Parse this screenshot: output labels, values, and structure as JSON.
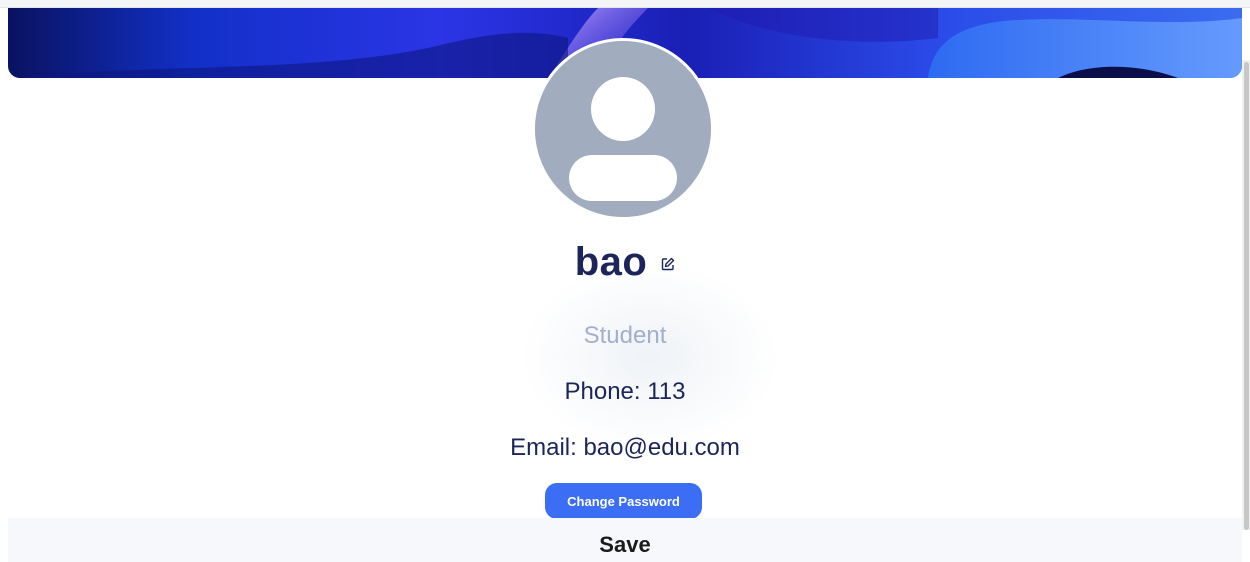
{
  "profile": {
    "name": "bao",
    "role": "Student",
    "phone": "Phone: 113",
    "email": "Email: bao@edu.com"
  },
  "actions": {
    "change_password_label": "Change Password",
    "save_label": "Save"
  },
  "icons": {
    "edit": "edit-icon",
    "avatar": "user-avatar-icon"
  },
  "colors": {
    "name_text": "#1b2559",
    "role_text": "#a3aed0",
    "primary_button": "#3b6ef5",
    "avatar_bg": "#a1adbf",
    "cover_dark": "#0b1a6e",
    "cover_bright": "#2f2ff0"
  }
}
